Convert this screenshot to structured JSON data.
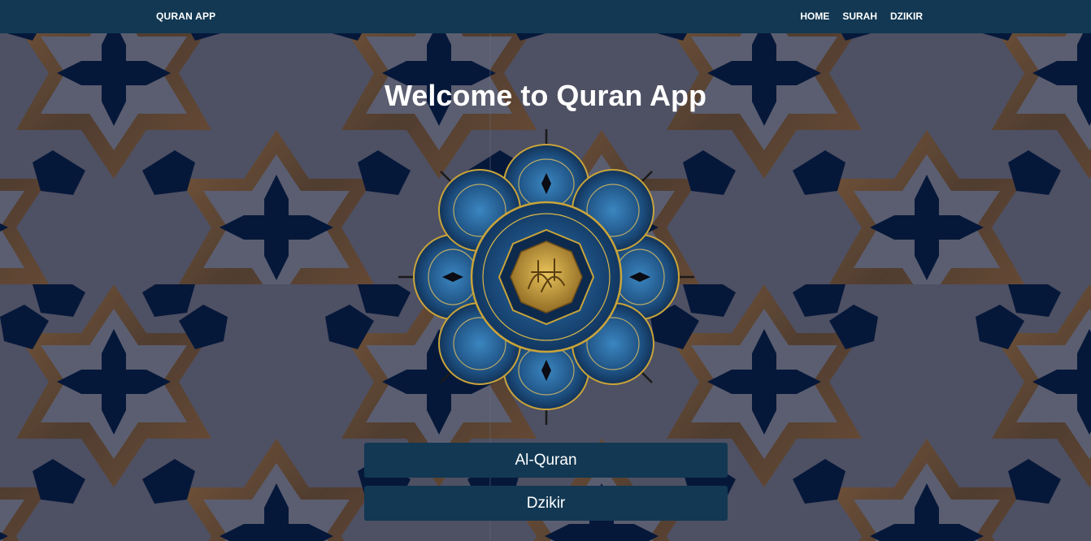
{
  "navbar": {
    "brand": "QURAN APP",
    "links": [
      "HOME",
      "SURAH",
      "DZIKIR"
    ]
  },
  "hero": {
    "title": "Welcome to Quran App"
  },
  "buttons": {
    "quran": "Al-Quran",
    "dzikir": "Dzikir"
  },
  "colors": {
    "navbar": "#123853",
    "button": "#123853",
    "background_base": "#4e5063",
    "pattern_dark": "#06183a",
    "pattern_brown": "#6a4a2c",
    "emblem_gold": "#c9a43a",
    "emblem_blue": "#2a6aa0"
  },
  "icons": {
    "emblem": "quran-calligraphy-emblem"
  }
}
